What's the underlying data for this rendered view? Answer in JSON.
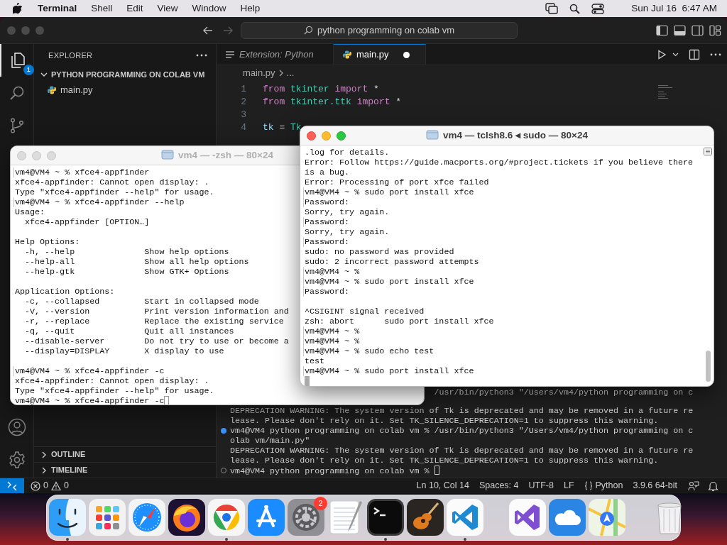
{
  "menu_bar": {
    "app": "Terminal",
    "menus": [
      "Shell",
      "Edit",
      "View",
      "Window",
      "Help"
    ],
    "clock": "Sun Jul 16  6:47 AM"
  },
  "vscode": {
    "command_center": "python programming on colab vm",
    "activity_bar": {
      "files_badge": "1"
    },
    "explorer": {
      "title": "EXPLORER",
      "folder": {
        "name": "PYTHON PROGRAMMING ON COLAB VM",
        "expanded": true,
        "files": [
          "main.py"
        ]
      },
      "sections": [
        {
          "name": "OUTLINE",
          "expanded": false
        },
        {
          "name": "TIMELINE",
          "expanded": false
        }
      ]
    },
    "tabs": [
      {
        "label": "Extension: Python",
        "kind": "preview",
        "selected": false,
        "modified": false
      },
      {
        "label": "main.py",
        "kind": "python",
        "selected": true,
        "modified": true
      }
    ],
    "breadcrumb": [
      "main.py",
      "..."
    ],
    "code": [
      {
        "number": "1",
        "tokens": [
          {
            "text": "from",
            "kind": "keyword"
          },
          {
            "text": "tkinter",
            "kind": "module"
          },
          {
            "text": "import",
            "kind": "keyword"
          },
          {
            "text": "*",
            "kind": "plain"
          }
        ]
      },
      {
        "number": "2",
        "tokens": [
          {
            "text": "from",
            "kind": "keyword"
          },
          {
            "text": "tkinter.ttk",
            "kind": "module"
          },
          {
            "text": "import",
            "kind": "keyword"
          },
          {
            "text": "*",
            "kind": "plain"
          }
        ]
      },
      {
        "number": "3"
      },
      {
        "number": "4",
        "tokens": [
          {
            "text": "tk",
            "kind": "variable"
          },
          {
            "text": "=",
            "kind": "plain"
          },
          {
            "text": "Tk",
            "kind": "module"
          }
        ]
      }
    ],
    "terminal": [
      {
        "text": "/usr/bin/python3 \"/Users/vm4/python programming on c",
        "kind": "partial"
      },
      {
        "text": "DEPRECATION WARNING: The system version of Tk is deprecated and may be removed in a future re",
        "kind": "plain"
      },
      {
        "text": "lease. Please don't rely on it. Set TK_SILENCE_DEPRECATION=1 to suppress this warning.",
        "kind": "plain"
      },
      {
        "text": "vm4@VM4 python programming on colab vm % /usr/bin/python3 \"/Users/vm4/python programming on c",
        "kind": "success"
      },
      {
        "text": "olab vm/main.py\"",
        "kind": "plain"
      },
      {
        "text": "DEPRECATION WARNING: The system version of Tk is deprecated and may be removed in a future re",
        "kind": "plain"
      },
      {
        "text": "lease. Please don't rely on it. Set TK_SILENCE_DEPRECATION=1 to suppress this warning.",
        "kind": "plain"
      },
      {
        "text": "vm4@VM4 python programming on colab vm %",
        "kind": "idle",
        "cursor": true
      }
    ],
    "status_bar": {
      "problems": [
        {
          "kind": "error",
          "count": "0"
        },
        {
          "kind": "warning",
          "count": "0"
        }
      ],
      "items": [
        {
          "text": "Ln 10, Col 14",
          "kind": "plain"
        },
        {
          "text": "Spaces: 4",
          "kind": "plain"
        },
        {
          "text": "UTF-8",
          "kind": "plain"
        },
        {
          "text": "LF",
          "kind": "plain"
        },
        {
          "text": "Python",
          "kind": "language"
        },
        {
          "text": "3.9.6 64-bit",
          "kind": "plain"
        }
      ]
    }
  },
  "terminals": [
    {
      "title": "vm4 — -zsh — 80×24",
      "active": false,
      "scrollbar": false,
      "lines": [
        {
          "kind": "prompt",
          "text": "vm4@VM4 ~ % xfce4-appfinder",
          "marked": true
        },
        {
          "kind": "output",
          "text": "xfce4-appfinder: Cannot open display: ."
        },
        {
          "kind": "output",
          "text": "Type \"xfce4-appfinder --help\" for usage."
        },
        {
          "kind": "prompt",
          "text": "vm4@VM4 ~ % xfce4-appfinder --help",
          "marked": true
        },
        {
          "kind": "output",
          "text": "Usage:"
        },
        {
          "kind": "indent",
          "text": "xfce4-appfinder [OPTION…]"
        },
        {
          "kind": "blank"
        },
        {
          "kind": "output",
          "text": "Help Options:"
        },
        {
          "kind": "option",
          "option": "-h, --help",
          "text": "Show help options"
        },
        {
          "kind": "option",
          "option": "--help-all",
          "text": "Show all help options"
        },
        {
          "kind": "option",
          "option": "--help-gtk",
          "text": "Show GTK+ Options"
        },
        {
          "kind": "blank"
        },
        {
          "kind": "output",
          "text": "Application Options:"
        },
        {
          "kind": "option",
          "option": "-c, --collapsed",
          "text": "Start in collapsed mode"
        },
        {
          "kind": "option",
          "option": "-V, --version",
          "text": "Print version information and"
        },
        {
          "kind": "option",
          "option": "-r, --replace",
          "text": "Replace the existing service"
        },
        {
          "kind": "option",
          "option": "-q, --quit",
          "text": "Quit all instances"
        },
        {
          "kind": "option",
          "option": "--disable-server",
          "text": "Do not try to use or become a"
        },
        {
          "kind": "option",
          "option": "--display=DISPLAY",
          "text": "X display to use"
        },
        {
          "kind": "blank"
        },
        {
          "kind": "prompt",
          "text": "vm4@VM4 ~ % xfce4-appfinder -c",
          "marked": true
        },
        {
          "kind": "output",
          "text": "xfce4-appfinder: Cannot open display: ."
        },
        {
          "kind": "output",
          "text": "Type \"xfce4-appfinder --help\" for usage."
        },
        {
          "kind": "prompt",
          "text": "vm4@VM4 ~ % xfce4-appfinder -c",
          "cursor": true
        }
      ]
    },
    {
      "title": "vm4 — tclsh8.6 ◂ sudo — 80×24",
      "active": true,
      "scrollbar": true,
      "lines": [
        {
          "kind": "output",
          "text": ".log for details."
        },
        {
          "kind": "output",
          "text": "Error: Follow https://guide.macports.org/#project.tickets if you believe there"
        },
        {
          "kind": "output",
          "text": "is a bug."
        },
        {
          "kind": "output",
          "text": "Error: Processing of port xfce failed"
        },
        {
          "kind": "prompt",
          "text": "vm4@VM4 ~ % sudo port install xfce",
          "marked": true
        },
        {
          "kind": "output",
          "text": "Password:",
          "marked": true
        },
        {
          "kind": "output",
          "text": "Sorry, try again."
        },
        {
          "kind": "output",
          "text": "Password:",
          "marked": true
        },
        {
          "kind": "output",
          "text": "Sorry, try again."
        },
        {
          "kind": "output",
          "text": "Password:",
          "marked": true
        },
        {
          "kind": "output",
          "text": "sudo: no password was provided"
        },
        {
          "kind": "output",
          "text": "sudo: 2 incorrect password attempts"
        },
        {
          "kind": "prompt",
          "text": "vm4@VM4 ~ %",
          "marked": true
        },
        {
          "kind": "prompt",
          "text": "vm4@VM4 ~ % sudo port install xfce",
          "marked": true
        },
        {
          "kind": "output",
          "text": "Password:",
          "marked": true
        },
        {
          "kind": "blank"
        },
        {
          "kind": "output",
          "text": "^CSIGINT signal received"
        },
        {
          "kind": "output",
          "text": "zsh: abort      sudo port install xfce"
        },
        {
          "kind": "prompt",
          "text": "vm4@VM4 ~ %",
          "marked": true
        },
        {
          "kind": "prompt",
          "text": "vm4@VM4 ~ %",
          "marked": true
        },
        {
          "kind": "prompt",
          "text": "vm4@VM4 ~ % sudo echo test",
          "marked": true
        },
        {
          "kind": "output",
          "text": "test"
        },
        {
          "kind": "prompt",
          "text": "vm4@VM4 ~ % sudo port install xfce",
          "marked": true
        },
        {
          "kind": "blank",
          "cursor": true
        }
      ]
    }
  ],
  "dock": {
    "groups": [
      [
        {
          "kind": "finder",
          "running": true
        },
        {
          "kind": "launchpad"
        },
        {
          "kind": "safari"
        },
        {
          "kind": "firefox"
        },
        {
          "kind": "chrome",
          "running": true
        },
        {
          "kind": "appstore"
        },
        {
          "kind": "settings",
          "badge": "2"
        },
        {
          "kind": "textedit"
        },
        {
          "kind": "terminal",
          "running": true
        },
        {
          "kind": "garageband"
        },
        {
          "kind": "vscode",
          "running": true
        }
      ],
      [
        {
          "kind": "visualstudio"
        },
        {
          "kind": "weather"
        },
        {
          "kind": "maps"
        }
      ],
      [
        {
          "kind": "trash"
        }
      ]
    ]
  }
}
